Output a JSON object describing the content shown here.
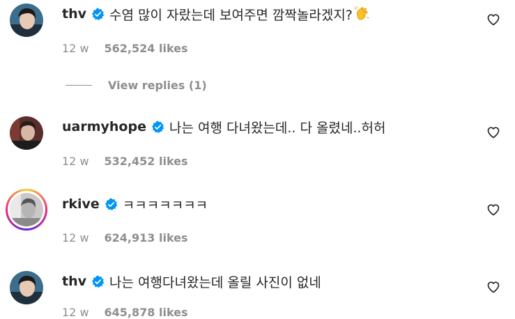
{
  "comments": [
    {
      "username": "thv",
      "text": "수염 많이 자랐는데 보여주면 깜짝놀라겠지?",
      "emoji": "clapping-hands",
      "age": "12 w",
      "likes": "562,524 likes",
      "view_replies": "View replies (1)"
    },
    {
      "username": "uarmyhope",
      "text": "나는 여행 다녀왔는데.. 다 올렸네..허허",
      "age": "12 w",
      "likes": "532,452 likes"
    },
    {
      "username": "rkive",
      "text": "ㅋㅋㅋㅋㅋㅋㅋ",
      "age": "12 w",
      "likes": "624,913 likes"
    },
    {
      "username": "thv",
      "text": "나는 여행다녀왔는데 올릴 사진이 없네",
      "age": "12 w",
      "likes": "645,878 likes"
    }
  ],
  "colors": {
    "text": "#262626",
    "secondary": "#8e8e8e",
    "verified": "#0095f6"
  },
  "icons": {
    "verified": "verified-badge-icon",
    "like": "heart-icon"
  }
}
